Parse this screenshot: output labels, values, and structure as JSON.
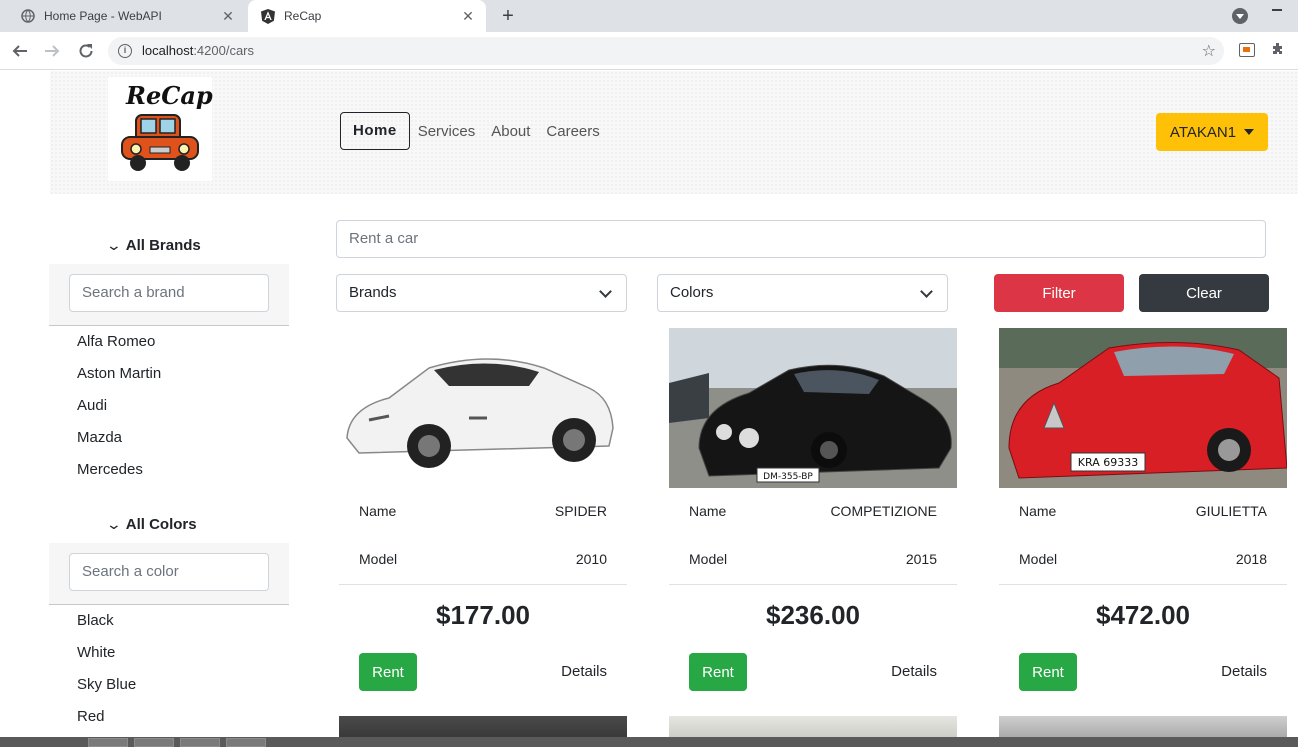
{
  "browser": {
    "tabs": [
      {
        "title": "Home Page - WebAPI",
        "active": false
      },
      {
        "title": "ReCap",
        "active": true
      }
    ],
    "url_host": "localhost",
    "url_path": ":4200/cars"
  },
  "header": {
    "logo_text": "ReCap",
    "nav": {
      "home": "Home",
      "services": "Services",
      "about": "About",
      "careers": "Careers"
    },
    "user_menu": "ATAKAN1"
  },
  "sidebar": {
    "brands_title": "All Brands",
    "brand_search_placeholder": "Search a brand",
    "brands": [
      "Alfa Romeo",
      "Aston Martin",
      "Audi",
      "Mazda",
      "Mercedes"
    ],
    "colors_title": "All Colors",
    "color_search_placeholder": "Search a color",
    "colors": [
      "Black",
      "White",
      "Sky Blue",
      "Red"
    ]
  },
  "filters": {
    "rent_placeholder": "Rent a car",
    "brands_select": "Brands",
    "colors_select": "Colors",
    "filter_label": "Filter",
    "clear_label": "Clear"
  },
  "cards": [
    {
      "name_label": "Name",
      "name": "SPIDER",
      "model_label": "Model",
      "model": "2010",
      "price": "$177.00",
      "rent": "Rent",
      "details": "Details",
      "car_color": "#f2f2f2",
      "plate": ""
    },
    {
      "name_label": "Name",
      "name": "COMPETIZIONE",
      "model_label": "Model",
      "model": "2015",
      "price": "$236.00",
      "rent": "Rent",
      "details": "Details",
      "car_color": "#151515",
      "plate": "DM-355-BP"
    },
    {
      "name_label": "Name",
      "name": "GIULIETTA",
      "model_label": "Model",
      "model": "2018",
      "price": "$472.00",
      "rent": "Rent",
      "details": "Details",
      "car_color": "#d81f26",
      "plate": "KRA 69333"
    }
  ],
  "colors": {
    "filter": "#dc3545",
    "clear": "#343a40",
    "rent": "#28a745",
    "user": "#ffc107"
  }
}
